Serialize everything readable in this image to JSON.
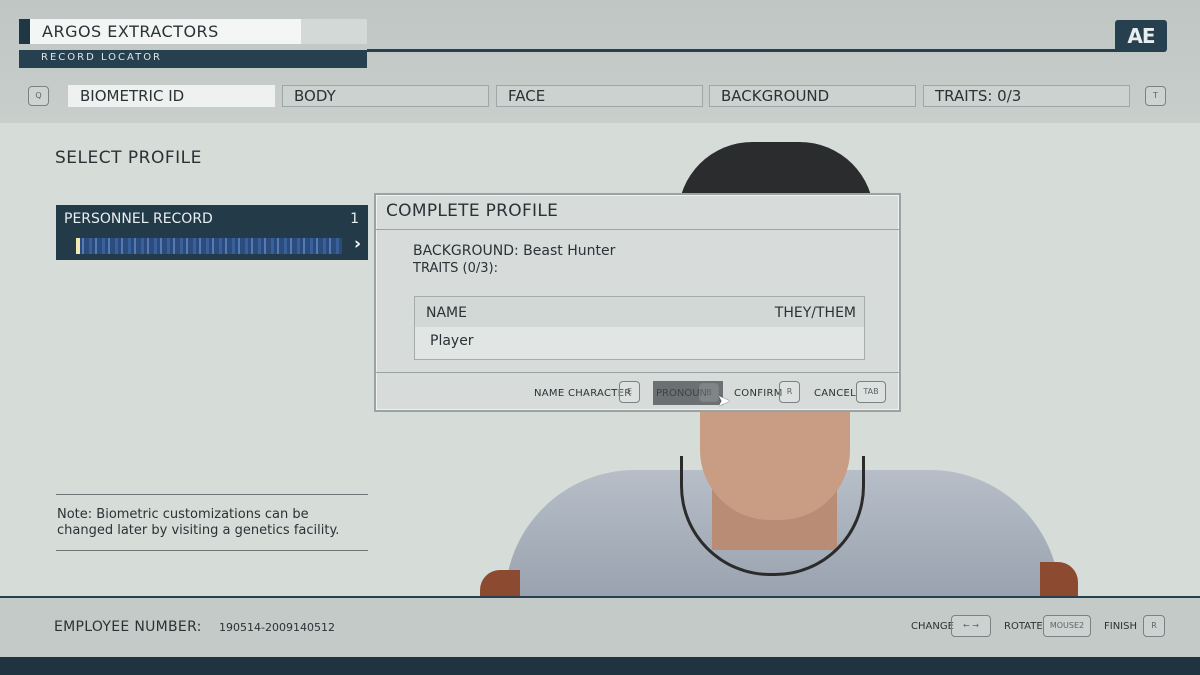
{
  "header": {
    "company": "ARGOS EXTRACTORS",
    "subtitle": "RECORD LOCATOR",
    "logo": "AE",
    "prev_key": "Q",
    "next_key": "T"
  },
  "tabs": [
    {
      "label": "BIOMETRIC ID",
      "active": true
    },
    {
      "label": "BODY",
      "active": false
    },
    {
      "label": "FACE",
      "active": false
    },
    {
      "label": "BACKGROUND",
      "active": false
    },
    {
      "label": "TRAITS: 0/3",
      "active": false
    }
  ],
  "left_panel": {
    "heading": "SELECT PROFILE",
    "record_label": "PERSONNEL RECORD",
    "record_number": "1",
    "arrow": "›",
    "note": "Note: Biometric customizations can be changed later by visiting a genetics facility."
  },
  "dialog": {
    "title": "COMPLETE PROFILE",
    "background_label": "BACKGROUND:",
    "background_value": "Beast Hunter",
    "traits_label": "TRAITS (0/3):",
    "name_header": "NAME",
    "pronoun_header": "THEY/THEM",
    "name_value": "Player",
    "actions": {
      "name_character": "NAME CHARACTER",
      "name_character_key": "E",
      "pronoun": "PRONOUN",
      "pronoun_key": "B",
      "confirm": "CONFIRM",
      "confirm_key": "R",
      "cancel": "CANCEL",
      "cancel_key": "TAB"
    }
  },
  "footer": {
    "employee_label": "EMPLOYEE NUMBER:",
    "employee_number": "190514-2009140512",
    "change_label": "CHANGE",
    "change_key": "← →",
    "rotate_label": "ROTATE",
    "rotate_key": "MOUSE2",
    "finish_label": "FINISH",
    "finish_key": "R"
  },
  "colors": {
    "accent_dark": "#27404f",
    "panel_bg": "#d7dcda"
  }
}
